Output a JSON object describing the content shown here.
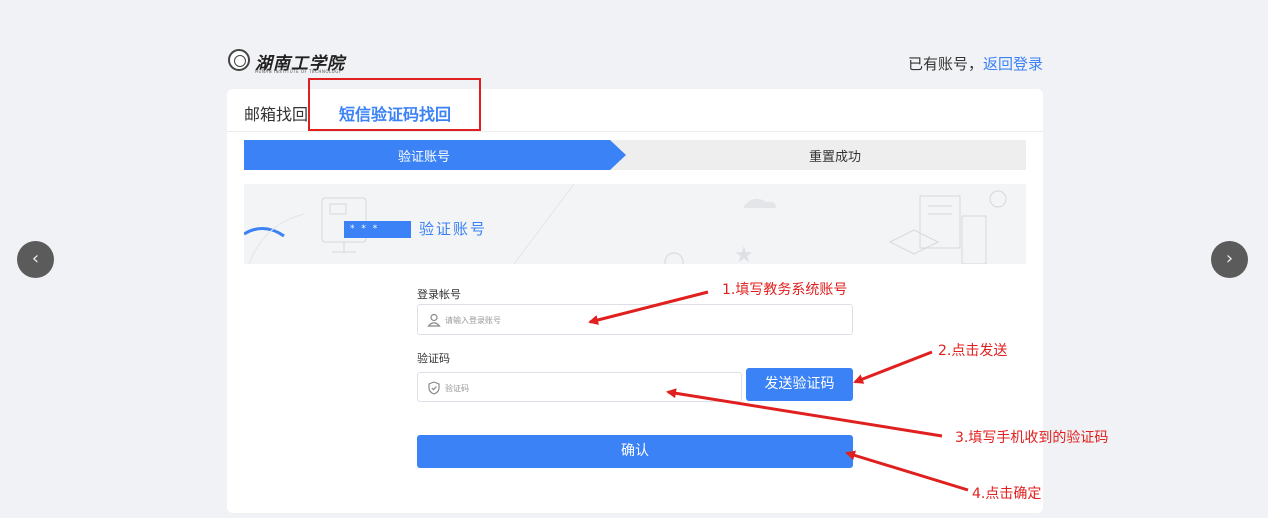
{
  "header": {
    "logo_text": "湖南工学院",
    "logo_subtext": "HUNAN INSTITUTE OF TECHNOLOGY",
    "has_account_text": "已有账号，",
    "back_login_link": "返回登录"
  },
  "tabs": [
    {
      "label": "邮箱找回",
      "active": false
    },
    {
      "label": "短信验证码找回",
      "active": true
    }
  ],
  "steps": [
    {
      "label": "验证账号",
      "active": true
    },
    {
      "label": "重置成功",
      "active": false
    }
  ],
  "banner": {
    "title": "验证账号",
    "password_chip": "* * *"
  },
  "form": {
    "account_label": "登录帐号",
    "account_placeholder": "请输入登录账号",
    "code_label": "验证码",
    "code_placeholder": "验证码",
    "send_code_button": "发送验证码",
    "confirm_button": "确认"
  },
  "annotations": [
    "1.填写教务系统账号",
    "2.点击发送",
    "3.填写手机收到的验证码",
    "4.点击确定"
  ],
  "carousel": {
    "prev_icon": "chevron-left-icon",
    "next_icon": "chevron-right-icon"
  },
  "colors": {
    "primary": "#3b82f6",
    "annotation_red": "#e0201f",
    "background": "#f1f2f5"
  }
}
